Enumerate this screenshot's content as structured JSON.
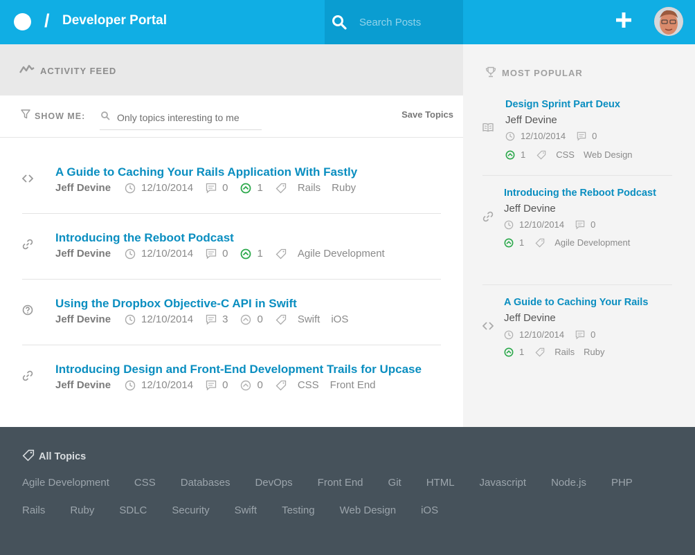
{
  "header": {
    "slash": "/",
    "title": "Developer Portal",
    "search_placeholder": "Search Posts"
  },
  "feed": {
    "heading": "ACTIVITY FEED",
    "filter_label": "SHOW ME:",
    "filter_placeholder": "Only topics interesting to me",
    "save_label": "Save Topics",
    "items": [
      {
        "type_icon": "code-icon",
        "title": "A Guide to Caching Your Rails Application With Fastly",
        "author": "Jeff Devine",
        "date": "12/10/2014",
        "comments": "0",
        "upvotes": "1",
        "upvoted": true,
        "tags": [
          "Rails",
          "Ruby"
        ]
      },
      {
        "type_icon": "link-icon",
        "title": "Introducing the Reboot Podcast",
        "author": "Jeff Devine",
        "date": "12/10/2014",
        "comments": "0",
        "upvotes": "1",
        "upvoted": true,
        "tags": [
          "Agile Development"
        ]
      },
      {
        "type_icon": "question-icon",
        "title": "Using the Dropbox Objective-C API in Swift",
        "author": "Jeff Devine",
        "date": "12/10/2014",
        "comments": "3",
        "upvotes": "0",
        "upvoted": false,
        "tags": [
          "Swift",
          "iOS"
        ]
      },
      {
        "type_icon": "link-icon",
        "title": "Introducing Design and Front-End Development Trails for Upcase",
        "author": "Jeff Devine",
        "date": "12/10/2014",
        "comments": "0",
        "upvotes": "0",
        "upvoted": false,
        "tags": [
          "CSS",
          "Front End"
        ]
      }
    ]
  },
  "popular": {
    "heading": "MOST POPULAR",
    "items": [
      {
        "type_icon": "book-icon",
        "title": "Design Sprint Part Deux",
        "author": "Jeff Devine",
        "date": "12/10/2014",
        "comments": "0",
        "upvotes": "1",
        "tags": [
          "CSS",
          "Web Design"
        ]
      },
      {
        "type_icon": "link-icon",
        "title": "Introducing the Reboot Podcast",
        "author": "Jeff Devine",
        "date": "12/10/2014",
        "comments": "0",
        "upvotes": "1",
        "tags": [
          "Agile Development"
        ]
      },
      {
        "type_icon": "code-icon",
        "title": "A Guide to Caching Your Rails",
        "author": "Jeff Devine",
        "date": "12/10/2014",
        "comments": "0",
        "upvotes": "1",
        "tags": [
          "Rails",
          "Ruby"
        ]
      }
    ]
  },
  "footer": {
    "title": "All Topics",
    "topics_row1": [
      "Agile Development",
      "CSS",
      "Databases",
      "DevOps",
      "Front End",
      "Git",
      "HTML",
      "Javascript",
      "Node.js",
      "PHP"
    ],
    "topics_row2": [
      "Rails",
      "Ruby",
      "SDLC",
      "Security",
      "Swift",
      "Testing",
      "Web Design",
      "iOS"
    ]
  },
  "colors": {
    "brand": "#10aee4",
    "link": "#0a8ec0",
    "upvote_active": "#2aa84a",
    "footer_bg": "#46525b"
  }
}
